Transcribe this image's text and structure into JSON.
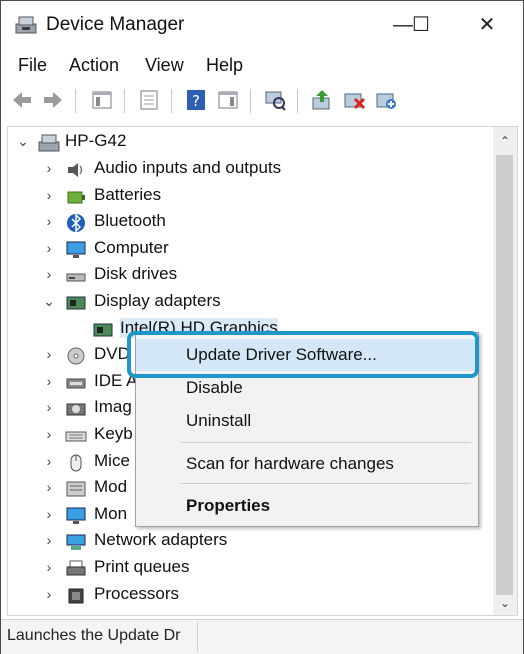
{
  "window": {
    "title": "Device Manager",
    "minimize": "—",
    "maximize": "☐",
    "close": "✕"
  },
  "menubar": [
    "File",
    "Action",
    "View",
    "Help"
  ],
  "toolbar": {
    "icons": [
      "back-arrow-icon",
      "forward-arrow-icon",
      "show-hide-console-tree-icon",
      "properties-icon",
      "help-icon",
      "action-pane-icon",
      "scan-hardware-icon",
      "update-driver-icon",
      "uninstall-device-icon",
      "add-legacy-hardware-icon"
    ]
  },
  "tree": {
    "root": "HP-G42",
    "items": [
      {
        "label": "Audio inputs and outputs",
        "icon": "speaker-icon"
      },
      {
        "label": "Batteries",
        "icon": "battery-icon"
      },
      {
        "label": "Bluetooth",
        "icon": "bluetooth-icon"
      },
      {
        "label": "Computer",
        "icon": "monitor-icon"
      },
      {
        "label": "Disk drives",
        "icon": "disk-drive-icon"
      },
      {
        "label": "Display adapters",
        "icon": "display-adapter-icon",
        "expanded": true
      },
      {
        "label": "Intel(R) HD Graphics",
        "icon": "display-adapter-icon",
        "child": true,
        "selected": true
      },
      {
        "label": "DVD",
        "icon": "dvd-icon"
      },
      {
        "label": "IDE A",
        "icon": "ide-controller-icon"
      },
      {
        "label": "Imag",
        "icon": "imaging-device-icon"
      },
      {
        "label": "Keyb",
        "icon": "keyboard-icon"
      },
      {
        "label": "Mice",
        "icon": "mouse-icon"
      },
      {
        "label": "Mod",
        "icon": "modem-icon"
      },
      {
        "label": "Mon",
        "icon": "monitor-icon"
      },
      {
        "label": "Network adapters",
        "icon": "network-adapter-icon"
      },
      {
        "label": "Print queues",
        "icon": "printer-icon"
      },
      {
        "label": "Processors",
        "icon": "processor-icon"
      }
    ]
  },
  "context_menu": {
    "items": [
      "Update Driver Software...",
      "Disable",
      "Uninstall",
      "Scan for hardware changes",
      "Properties"
    ]
  },
  "status_bar": {
    "text": "Launches the Update Dr"
  },
  "colors": {
    "accent": "#1f97c9",
    "selection": "#d9ebf9",
    "menu_highlight": "#d3e7f8"
  }
}
